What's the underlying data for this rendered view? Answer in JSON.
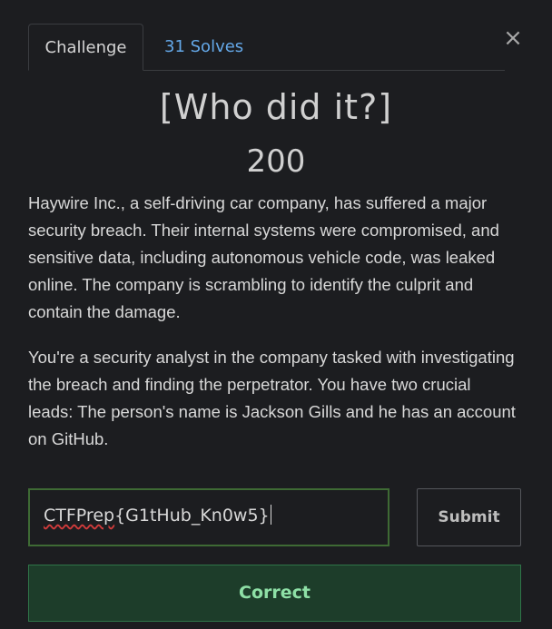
{
  "tabs": {
    "challenge_label": "Challenge",
    "solves_label": "31 Solves"
  },
  "close_icon": "×",
  "challenge": {
    "title": "[Who did it?]",
    "value": "200",
    "description": [
      "Haywire Inc., a self-driving car company, has suffered a major security breach. Their internal systems were compromised, and sensitive data, including autonomous vehicle code, was leaked online. The company is scrambling to identify the culprit and contain the damage.",
      "You're a security analyst in the company tasked with investigating the breach and finding the perpetrator. You have two crucial leads: The person's name is Jackson Gills and he has an account on GitHub."
    ]
  },
  "form": {
    "flag_prefix": "CTFPrep",
    "flag_rest": "{G1tHub_Kn0w5}",
    "submit_label": "Submit",
    "result_message": "Correct"
  },
  "colors": {
    "background": "#1c1d20",
    "link": "#64a8e8",
    "success_bg": "#1d3d2a",
    "success_text": "#8ee0a6",
    "input_border": "#3e6a34"
  }
}
